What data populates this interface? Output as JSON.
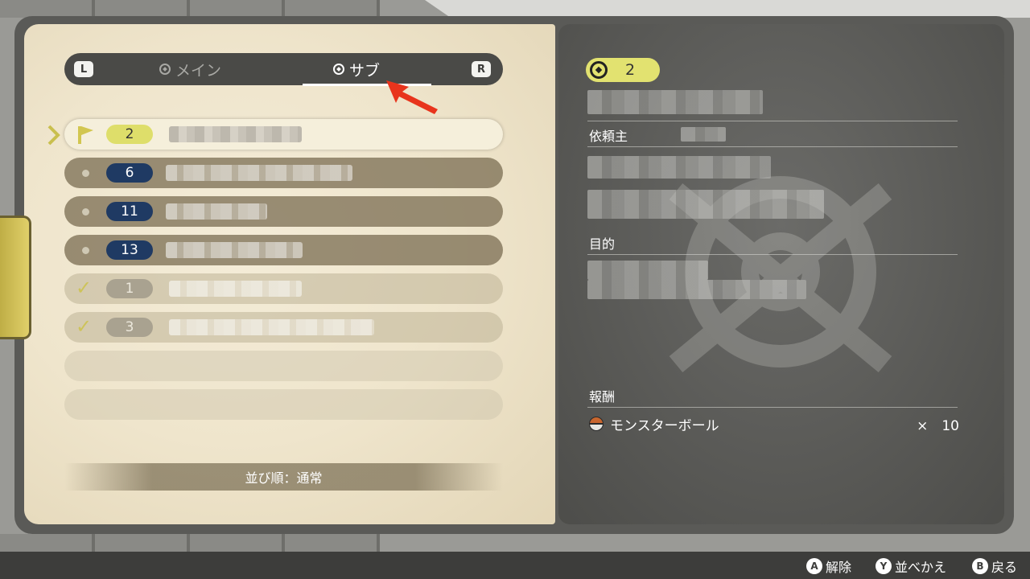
{
  "tabs": {
    "left_button": "L",
    "right_button": "R",
    "main_label": "メイン",
    "sub_label": "サブ"
  },
  "quests": [
    {
      "number": "2",
      "state": "selected"
    },
    {
      "number": "6",
      "state": "active"
    },
    {
      "number": "11",
      "state": "active"
    },
    {
      "number": "13",
      "state": "active"
    },
    {
      "number": "1",
      "state": "done"
    },
    {
      "number": "3",
      "state": "done"
    }
  ],
  "sort": {
    "label": "並び順：通常"
  },
  "detail": {
    "number": "2",
    "client_label": "依頼主",
    "objective_label": "目的",
    "reward_label": "報酬",
    "reward_item": "モンスターボール",
    "reward_qty": "×　10"
  },
  "controls": [
    {
      "button": "A",
      "label": "解除"
    },
    {
      "button": "Y",
      "label": "並べかえ"
    },
    {
      "button": "B",
      "label": "戻る"
    }
  ],
  "colors": {
    "active_badge": "#1f3a63",
    "selected_badge": "#dede6a",
    "arrow": "#e8341c"
  }
}
